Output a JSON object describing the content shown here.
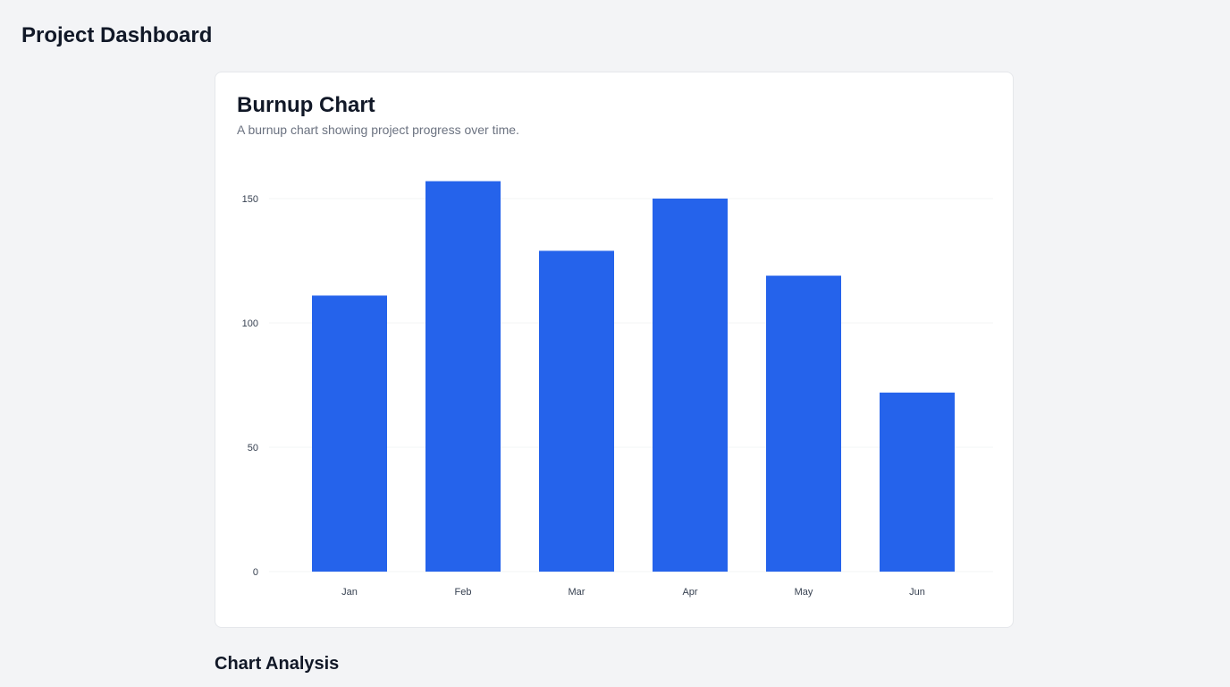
{
  "header": {
    "title": "Project Dashboard"
  },
  "card": {
    "title": "Burnup Chart",
    "description": "A burnup chart showing project progress over time."
  },
  "analysis": {
    "title": "Chart Analysis"
  },
  "colors": {
    "bar": "#2563eb",
    "grid": "#f3f4f6",
    "page_background": "#f3f4f6"
  },
  "chart_data": {
    "type": "bar",
    "categories": [
      "Jan",
      "Feb",
      "Mar",
      "Apr",
      "May",
      "Jun"
    ],
    "values": [
      111,
      157,
      129,
      150,
      119,
      72
    ],
    "yticks": [
      0,
      50,
      100,
      150
    ],
    "ylim": [
      0,
      150
    ],
    "grid": true
  }
}
